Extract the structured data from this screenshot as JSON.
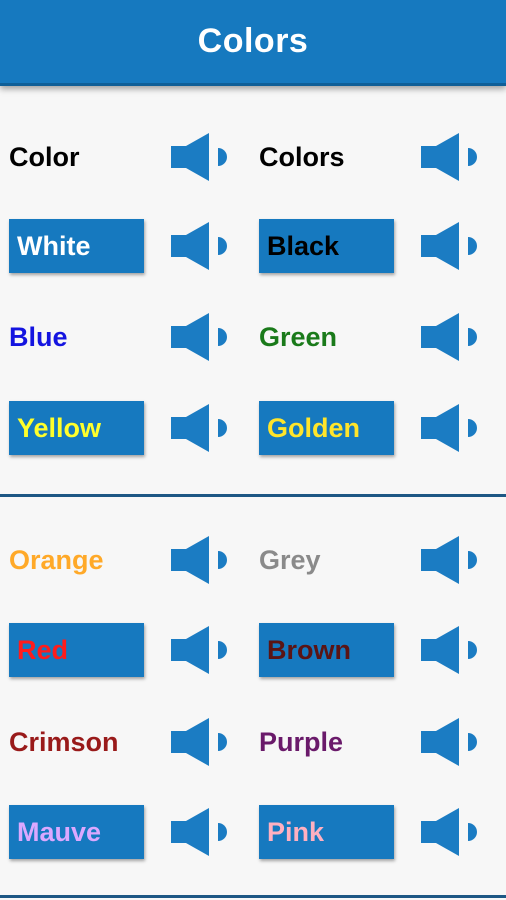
{
  "app_bar": {
    "title": "Colors"
  },
  "theme": {
    "primary": "#1679bf",
    "divider": "#1d5784",
    "speaker": "#1b7cc3"
  },
  "sections": [
    {
      "rows": [
        [
          {
            "word": "Color",
            "color": "#000000",
            "boxed": false
          },
          {
            "word": "Colors",
            "color": "#000000",
            "boxed": false
          }
        ],
        [
          {
            "word": "White",
            "color": "#ffffff",
            "boxed": true
          },
          {
            "word": "Black",
            "color": "#000000",
            "boxed": true
          }
        ],
        [
          {
            "word": "Blue",
            "color": "#1414e0",
            "boxed": false
          },
          {
            "word": "Green",
            "color": "#1a7a1a",
            "boxed": false
          }
        ],
        [
          {
            "word": "Yellow",
            "color": "#ffff2b",
            "boxed": true
          },
          {
            "word": "Golden",
            "color": "#ffe52b",
            "boxed": true
          }
        ]
      ]
    },
    {
      "rows": [
        [
          {
            "word": "Orange",
            "color": "#ffa928",
            "boxed": false
          },
          {
            "word": "Grey",
            "color": "#8a8a8a",
            "boxed": false
          }
        ],
        [
          {
            "word": "Red",
            "color": "#ff1c1c",
            "boxed": true
          },
          {
            "word": "Brown",
            "color": "#5a1414",
            "boxed": true
          }
        ],
        [
          {
            "word": "Crimson",
            "color": "#991a1a",
            "boxed": false
          },
          {
            "word": "Purple",
            "color": "#6a1a6a",
            "boxed": false
          }
        ],
        [
          {
            "word": "Mauve",
            "color": "#dba8ff",
            "boxed": true
          },
          {
            "word": "Pink",
            "color": "#ffb0c0",
            "boxed": true
          }
        ]
      ]
    }
  ],
  "icons": {
    "speaker": "speaker-icon"
  }
}
